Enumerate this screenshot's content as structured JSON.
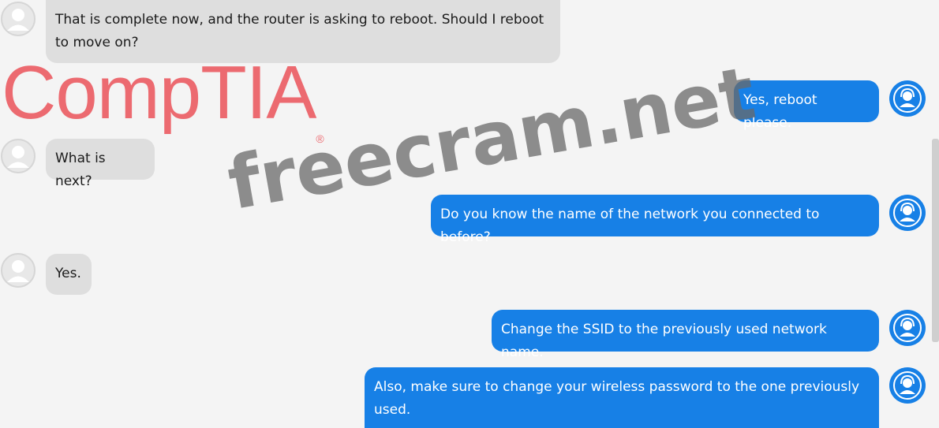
{
  "branding": {
    "logo_text": "CompTIA",
    "logo_mark": "®"
  },
  "watermark": "freecram.net",
  "colors": {
    "agent_bubble": "#1780e6",
    "user_bubble": "#dedede",
    "logo": "#ec6a70"
  },
  "messages": [
    {
      "sender": "user",
      "text": "That is complete now, and the router is asking to reboot. Should I reboot to move on?"
    },
    {
      "sender": "agent",
      "text": "Yes, reboot please."
    },
    {
      "sender": "user",
      "text": "What is next?"
    },
    {
      "sender": "agent",
      "text": "Do you know the name of the network you connected to before?"
    },
    {
      "sender": "user",
      "text": "Yes."
    },
    {
      "sender": "agent",
      "text": "Change the SSID to the previously used network name."
    },
    {
      "sender": "agent",
      "text": "Also, make sure to change your wireless password to the one previously used."
    }
  ]
}
